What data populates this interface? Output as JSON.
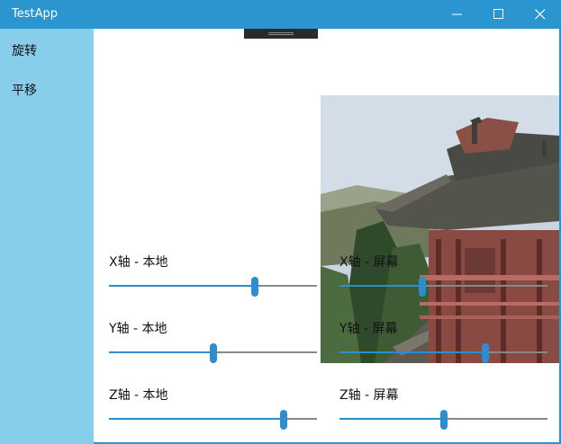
{
  "window": {
    "title": "TestApp"
  },
  "nav": {
    "items": [
      "旋转",
      "平移"
    ]
  },
  "sliders": [
    {
      "label": "X轴 - 本地",
      "value": 0.7
    },
    {
      "label": "X轴 - 屏幕",
      "value": 0.4
    },
    {
      "label": "Y轴 - 本地",
      "value": 0.5
    },
    {
      "label": "Y轴 - 屏幕",
      "value": 0.7
    },
    {
      "label": "Z轴 - 本地",
      "value": 0.84
    },
    {
      "label": "Z轴 - 屏幕",
      "value": 0.5
    }
  ],
  "colors": {
    "accent": "#2b8ed1",
    "titlebar": "#2b95d0",
    "sidebar": "#87ceeb"
  },
  "icons": {
    "minimize": "minimize-icon",
    "maximize": "maximize-icon",
    "close": "close-icon"
  }
}
